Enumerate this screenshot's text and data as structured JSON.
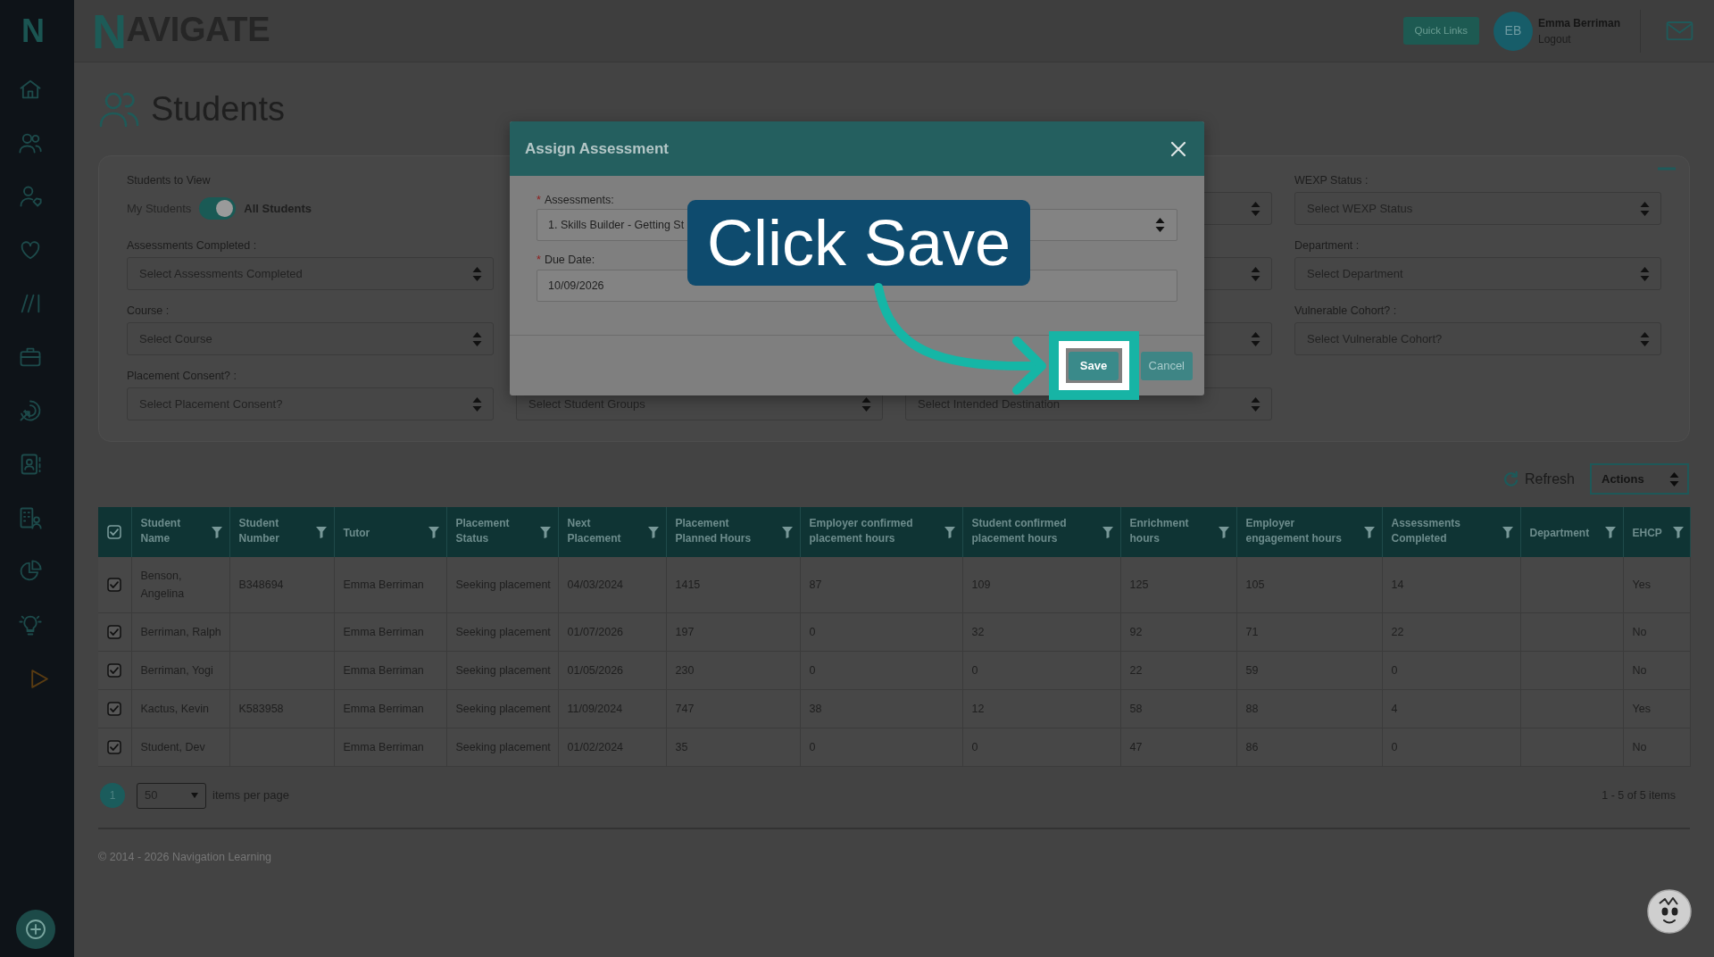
{
  "sidebar": {
    "logo": "N"
  },
  "header": {
    "logo": "NAVIGATE",
    "quick_links": "Quick Links",
    "user": {
      "initials": "EB",
      "name": "Emma Berriman",
      "logout": "Logout"
    }
  },
  "page": {
    "title": "Students"
  },
  "filters": {
    "rows": [
      [
        {
          "kind": "toggle",
          "label": "Students to View",
          "off_label": "My Students",
          "on_label": "All Students",
          "on": true
        },
        null,
        {
          "kind": "select"
        },
        {
          "kind": "select",
          "label": "WEXP Status :",
          "placeholder": "Select WEXP Status"
        }
      ],
      [
        {
          "kind": "select",
          "label": "Assessments Completed :",
          "placeholder": "Select Assessments Completed"
        },
        null,
        {
          "kind": "select"
        },
        {
          "kind": "select",
          "label": "Department :",
          "placeholder": "Select Department"
        }
      ],
      [
        {
          "kind": "select",
          "label": "Course :",
          "placeholder": "Select Course"
        },
        null,
        {
          "kind": "select"
        },
        {
          "kind": "select",
          "label": "Vulnerable Cohort? :",
          "placeholder": "Select Vulnerable Cohort?"
        }
      ],
      [
        {
          "kind": "select",
          "label": "Placement Consent? :",
          "placeholder": "Select Placement Consent?"
        },
        {
          "kind": "select",
          "placeholder": "Select Student Groups"
        },
        {
          "kind": "select",
          "placeholder": "Select Intended Destination"
        },
        null
      ]
    ]
  },
  "toolbar": {
    "refresh": "Refresh",
    "actions": "Actions"
  },
  "table": {
    "all_checked": true,
    "columns": [
      "Student Name",
      "Student Number",
      "Tutor",
      "Placement Status",
      "Next Placement",
      "Placement Planned Hours",
      "Employer confirmed placement hours",
      "Student confirmed placement hours",
      "Enrichment hours",
      "Employer engagement hours",
      "Assessments Completed",
      "Department",
      "EHCP"
    ],
    "rows": [
      {
        "checked": true,
        "cells": [
          "Benson, Angelina",
          "B348694",
          "Emma Berriman",
          "Seeking placement",
          "04/03/2024",
          "1415",
          "87",
          "109",
          "125",
          "105",
          "14",
          null,
          "Yes"
        ]
      },
      {
        "checked": true,
        "cells": [
          "Berriman, Ralph",
          null,
          "Emma Berriman",
          "Seeking placement",
          "01/07/2026",
          "197",
          "0",
          "32",
          "92",
          "71",
          "22",
          null,
          "No"
        ]
      },
      {
        "checked": true,
        "cells": [
          "Berriman, Yogi",
          null,
          "Emma Berriman",
          "Seeking placement",
          "01/05/2026",
          "230",
          "0",
          "0",
          "22",
          "59",
          "0",
          null,
          "No"
        ]
      },
      {
        "checked": true,
        "cells": [
          "Kactus, Kevin",
          "K583958",
          "Emma Berriman",
          "Seeking placement",
          "11/09/2024",
          "747",
          "38",
          "12",
          "58",
          "88",
          "4",
          null,
          "Yes"
        ]
      },
      {
        "checked": true,
        "cells": [
          "Student, Dev",
          null,
          "Emma Berriman",
          "Seeking placement",
          "01/02/2024",
          "35",
          "0",
          "0",
          "47",
          "86",
          "0",
          null,
          "No"
        ]
      }
    ]
  },
  "pagination": {
    "pages": [
      {
        "label": "1",
        "selected": true
      }
    ],
    "page_size": "50",
    "page_size_label": "items per page",
    "summary": "1 - 5 of 5 items"
  },
  "footer": {
    "copyright": "© 2014 - 2026 Navigation Learning"
  },
  "modal": {
    "title": "Assign Assessment",
    "fields": [
      {
        "kind": "select",
        "marker": "*",
        "label": "Assessments:",
        "value": "1. Skills Builder - Getting St"
      },
      {
        "kind": "date",
        "marker": "*",
        "label": "Due Date:",
        "value": "10/09/2026"
      }
    ],
    "buttons": [
      {
        "label": "Save",
        "highlighted": true
      },
      {
        "label": "Cancel",
        "highlighted": false
      }
    ]
  },
  "callout": {
    "text": "Click Save"
  }
}
